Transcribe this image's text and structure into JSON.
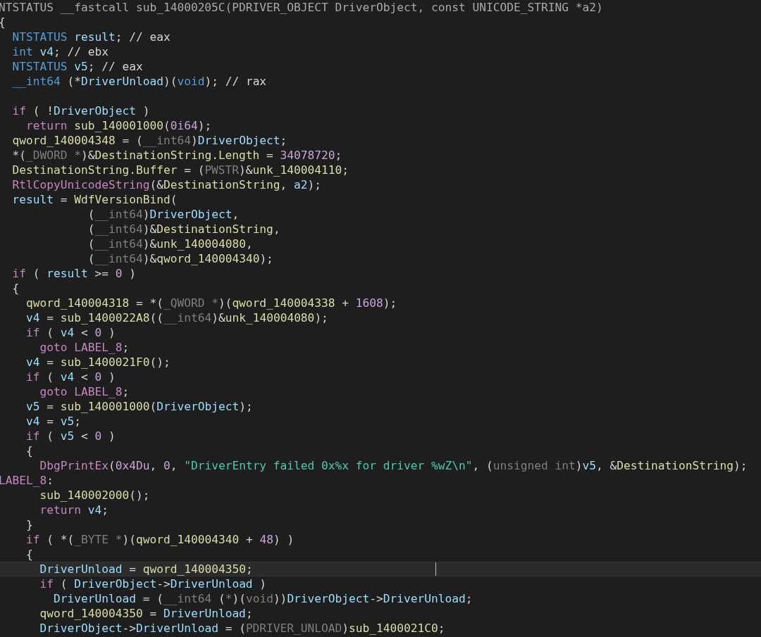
{
  "code_lines": [
    {
      "highlighted": false,
      "tokens": [
        {
          "kind": "header",
          "text": "NTSTATUS __fastcall sub_14000205C(PDRIVER_OBJECT DriverObject, const UNICODE_STRING *a2)"
        }
      ]
    },
    {
      "highlighted": false,
      "tokens": [
        {
          "kind": "plain",
          "text": "{"
        }
      ]
    },
    {
      "highlighted": false,
      "tokens": [
        {
          "kind": "type",
          "text": "  NTSTATUS "
        },
        {
          "kind": "variable",
          "text": "result"
        },
        {
          "kind": "plain",
          "text": "; // eax"
        }
      ]
    },
    {
      "highlighted": false,
      "tokens": [
        {
          "kind": "type",
          "text": "  int "
        },
        {
          "kind": "variable",
          "text": "v4"
        },
        {
          "kind": "plain",
          "text": "; // ebx"
        }
      ]
    },
    {
      "highlighted": false,
      "tokens": [
        {
          "kind": "type",
          "text": "  NTSTATUS "
        },
        {
          "kind": "variable",
          "text": "v5"
        },
        {
          "kind": "plain",
          "text": "; // eax"
        }
      ]
    },
    {
      "highlighted": false,
      "blank_line_after": true,
      "tokens": [
        {
          "kind": "type",
          "text": "  __int64"
        },
        {
          "kind": "plain",
          "text": " (*"
        },
        {
          "kind": "variable",
          "text": "DriverUnload"
        },
        {
          "kind": "plain",
          "text": ")("
        },
        {
          "kind": "type",
          "text": "void"
        },
        {
          "kind": "plain",
          "text": "); // rax"
        }
      ]
    },
    {
      "highlighted": false,
      "tokens": [
        {
          "kind": "keyword",
          "text": "  if"
        },
        {
          "kind": "plain",
          "text": " ( !"
        },
        {
          "kind": "variable",
          "text": "DriverObject"
        },
        {
          "kind": "plain",
          "text": " )"
        }
      ]
    },
    {
      "highlighted": false,
      "tokens": [
        {
          "kind": "keyword",
          "text": "    return "
        },
        {
          "kind": "global",
          "text": "sub_140001000"
        },
        {
          "kind": "plain",
          "text": "("
        },
        {
          "kind": "number",
          "text": "0i64"
        },
        {
          "kind": "plain",
          "text": ");"
        }
      ]
    },
    {
      "highlighted": false,
      "tokens": [
        {
          "kind": "global",
          "text": "  qword_140004348"
        },
        {
          "kind": "plain",
          "text": " = ("
        },
        {
          "kind": "cast",
          "text": "__int64"
        },
        {
          "kind": "plain",
          "text": ")"
        },
        {
          "kind": "variable",
          "text": "DriverObject"
        },
        {
          "kind": "plain",
          "text": ";"
        }
      ]
    },
    {
      "highlighted": false,
      "tokens": [
        {
          "kind": "plain",
          "text": "  *("
        },
        {
          "kind": "cast",
          "text": "_DWORD *"
        },
        {
          "kind": "plain",
          "text": ")&"
        },
        {
          "kind": "global",
          "text": "DestinationString.Length"
        },
        {
          "kind": "plain",
          "text": " = "
        },
        {
          "kind": "number",
          "text": "34078720"
        },
        {
          "kind": "plain",
          "text": ";"
        }
      ]
    },
    {
      "highlighted": false,
      "tokens": [
        {
          "kind": "global",
          "text": "  DestinationString.Buffer"
        },
        {
          "kind": "plain",
          "text": " = ("
        },
        {
          "kind": "cast",
          "text": "PWSTR"
        },
        {
          "kind": "plain",
          "text": ")&"
        },
        {
          "kind": "global",
          "text": "unk_140004110"
        },
        {
          "kind": "plain",
          "text": ";"
        }
      ]
    },
    {
      "highlighted": false,
      "tokens": [
        {
          "kind": "import",
          "text": "  RtlCopyUnicodeString"
        },
        {
          "kind": "plain",
          "text": "(&"
        },
        {
          "kind": "global",
          "text": "DestinationString"
        },
        {
          "kind": "plain",
          "text": ", "
        },
        {
          "kind": "variable",
          "text": "a2"
        },
        {
          "kind": "plain",
          "text": ");"
        }
      ]
    },
    {
      "highlighted": false,
      "tokens": [
        {
          "kind": "variable",
          "text": "  result"
        },
        {
          "kind": "plain",
          "text": " = "
        },
        {
          "kind": "global",
          "text": "WdfVersionBind"
        },
        {
          "kind": "plain",
          "text": "("
        }
      ]
    },
    {
      "highlighted": false,
      "tokens": [
        {
          "kind": "plain",
          "text": "             ("
        },
        {
          "kind": "cast",
          "text": "__int64"
        },
        {
          "kind": "plain",
          "text": ")"
        },
        {
          "kind": "variable",
          "text": "DriverObject"
        },
        {
          "kind": "plain",
          "text": ","
        }
      ]
    },
    {
      "highlighted": false,
      "tokens": [
        {
          "kind": "plain",
          "text": "             ("
        },
        {
          "kind": "cast",
          "text": "__int64"
        },
        {
          "kind": "plain",
          "text": ")&"
        },
        {
          "kind": "global",
          "text": "DestinationString"
        },
        {
          "kind": "plain",
          "text": ","
        }
      ]
    },
    {
      "highlighted": false,
      "tokens": [
        {
          "kind": "plain",
          "text": "             ("
        },
        {
          "kind": "cast",
          "text": "__int64"
        },
        {
          "kind": "plain",
          "text": ")&"
        },
        {
          "kind": "global",
          "text": "unk_140004080"
        },
        {
          "kind": "plain",
          "text": ","
        }
      ]
    },
    {
      "highlighted": false,
      "tokens": [
        {
          "kind": "plain",
          "text": "             ("
        },
        {
          "kind": "cast",
          "text": "__int64"
        },
        {
          "kind": "plain",
          "text": ")&"
        },
        {
          "kind": "global",
          "text": "qword_140004340"
        },
        {
          "kind": "plain",
          "text": ");"
        }
      ]
    },
    {
      "highlighted": false,
      "tokens": [
        {
          "kind": "keyword",
          "text": "  if"
        },
        {
          "kind": "plain",
          "text": " ( "
        },
        {
          "kind": "variable",
          "text": "result"
        },
        {
          "kind": "plain",
          "text": " >= "
        },
        {
          "kind": "number",
          "text": "0"
        },
        {
          "kind": "plain",
          "text": " )"
        }
      ]
    },
    {
      "highlighted": false,
      "tokens": [
        {
          "kind": "plain",
          "text": "  {"
        }
      ]
    },
    {
      "highlighted": false,
      "tokens": [
        {
          "kind": "global",
          "text": "    qword_140004318"
        },
        {
          "kind": "plain",
          "text": " = *("
        },
        {
          "kind": "cast",
          "text": "_QWORD *"
        },
        {
          "kind": "plain",
          "text": ")("
        },
        {
          "kind": "global",
          "text": "qword_140004338"
        },
        {
          "kind": "plain",
          "text": " + "
        },
        {
          "kind": "number",
          "text": "1608"
        },
        {
          "kind": "plain",
          "text": ");"
        }
      ]
    },
    {
      "highlighted": false,
      "tokens": [
        {
          "kind": "variable",
          "text": "    v4"
        },
        {
          "kind": "plain",
          "text": " = "
        },
        {
          "kind": "global",
          "text": "sub_1400022A8"
        },
        {
          "kind": "plain",
          "text": "(("
        },
        {
          "kind": "cast",
          "text": "__int64"
        },
        {
          "kind": "plain",
          "text": ")&"
        },
        {
          "kind": "global",
          "text": "unk_140004080"
        },
        {
          "kind": "plain",
          "text": ");"
        }
      ]
    },
    {
      "highlighted": false,
      "tokens": [
        {
          "kind": "keyword",
          "text": "    if"
        },
        {
          "kind": "plain",
          "text": " ( "
        },
        {
          "kind": "variable",
          "text": "v4"
        },
        {
          "kind": "plain",
          "text": " < "
        },
        {
          "kind": "number",
          "text": "0"
        },
        {
          "kind": "plain",
          "text": " )"
        }
      ]
    },
    {
      "highlighted": false,
      "tokens": [
        {
          "kind": "keyword",
          "text": "      goto "
        },
        {
          "kind": "label",
          "text": "LABEL_8"
        },
        {
          "kind": "plain",
          "text": ";"
        }
      ]
    },
    {
      "highlighted": false,
      "tokens": [
        {
          "kind": "variable",
          "text": "    v4"
        },
        {
          "kind": "plain",
          "text": " = "
        },
        {
          "kind": "global",
          "text": "sub_1400021F0"
        },
        {
          "kind": "plain",
          "text": "();"
        }
      ]
    },
    {
      "highlighted": false,
      "tokens": [
        {
          "kind": "keyword",
          "text": "    if"
        },
        {
          "kind": "plain",
          "text": " ( "
        },
        {
          "kind": "variable",
          "text": "v4"
        },
        {
          "kind": "plain",
          "text": " < "
        },
        {
          "kind": "number",
          "text": "0"
        },
        {
          "kind": "plain",
          "text": " )"
        }
      ]
    },
    {
      "highlighted": false,
      "tokens": [
        {
          "kind": "keyword",
          "text": "      goto "
        },
        {
          "kind": "label",
          "text": "LABEL_8"
        },
        {
          "kind": "plain",
          "text": ";"
        }
      ]
    },
    {
      "highlighted": false,
      "tokens": [
        {
          "kind": "variable",
          "text": "    v5"
        },
        {
          "kind": "plain",
          "text": " = "
        },
        {
          "kind": "global",
          "text": "sub_140001000"
        },
        {
          "kind": "plain",
          "text": "("
        },
        {
          "kind": "variable",
          "text": "DriverObject"
        },
        {
          "kind": "plain",
          "text": ");"
        }
      ]
    },
    {
      "highlighted": false,
      "tokens": [
        {
          "kind": "variable",
          "text": "    v4"
        },
        {
          "kind": "plain",
          "text": " = "
        },
        {
          "kind": "variable",
          "text": "v5"
        },
        {
          "kind": "plain",
          "text": ";"
        }
      ]
    },
    {
      "highlighted": false,
      "tokens": [
        {
          "kind": "keyword",
          "text": "    if"
        },
        {
          "kind": "plain",
          "text": " ( "
        },
        {
          "kind": "variable",
          "text": "v5"
        },
        {
          "kind": "plain",
          "text": " < "
        },
        {
          "kind": "number",
          "text": "0"
        },
        {
          "kind": "plain",
          "text": " )"
        }
      ]
    },
    {
      "highlighted": false,
      "tokens": [
        {
          "kind": "plain",
          "text": "    {"
        }
      ]
    },
    {
      "highlighted": false,
      "tokens": [
        {
          "kind": "import",
          "text": "      DbgPrintEx"
        },
        {
          "kind": "plain",
          "text": "("
        },
        {
          "kind": "number",
          "text": "0x4Du"
        },
        {
          "kind": "plain",
          "text": ", "
        },
        {
          "kind": "number",
          "text": "0"
        },
        {
          "kind": "plain",
          "text": ", "
        },
        {
          "kind": "string",
          "text": "\"DriverEntry failed 0x%x for driver %wZ\\n\""
        },
        {
          "kind": "plain",
          "text": ", ("
        },
        {
          "kind": "cast",
          "text": "unsigned int"
        },
        {
          "kind": "plain",
          "text": ")"
        },
        {
          "kind": "variable",
          "text": "v5"
        },
        {
          "kind": "plain",
          "text": ", &"
        },
        {
          "kind": "global",
          "text": "DestinationString"
        },
        {
          "kind": "plain",
          "text": ");"
        }
      ]
    },
    {
      "highlighted": false,
      "tokens": [
        {
          "kind": "label",
          "text": "LABEL_8"
        },
        {
          "kind": "plain",
          "text": ":"
        }
      ]
    },
    {
      "highlighted": false,
      "tokens": [
        {
          "kind": "global",
          "text": "      sub_140002000"
        },
        {
          "kind": "plain",
          "text": "();"
        }
      ]
    },
    {
      "highlighted": false,
      "tokens": [
        {
          "kind": "keyword",
          "text": "      return "
        },
        {
          "kind": "variable",
          "text": "v4"
        },
        {
          "kind": "plain",
          "text": ";"
        }
      ]
    },
    {
      "highlighted": false,
      "tokens": [
        {
          "kind": "plain",
          "text": "    }"
        }
      ]
    },
    {
      "highlighted": false,
      "tokens": [
        {
          "kind": "keyword",
          "text": "    if"
        },
        {
          "kind": "plain",
          "text": " ( *("
        },
        {
          "kind": "cast",
          "text": "_BYTE *"
        },
        {
          "kind": "plain",
          "text": ")("
        },
        {
          "kind": "global",
          "text": "qword_140004340"
        },
        {
          "kind": "plain",
          "text": " + "
        },
        {
          "kind": "number",
          "text": "48"
        },
        {
          "kind": "plain",
          "text": ") )"
        }
      ]
    },
    {
      "highlighted": false,
      "tokens": [
        {
          "kind": "plain",
          "text": "    {"
        }
      ]
    },
    {
      "highlighted": true,
      "tokens": [
        {
          "kind": "variable",
          "text": "      DriverUnload"
        },
        {
          "kind": "plain",
          "text": " = "
        },
        {
          "kind": "global",
          "text": "qword_140004350"
        },
        {
          "kind": "plain",
          "text": ";"
        }
      ]
    },
    {
      "highlighted": false,
      "tokens": [
        {
          "kind": "keyword",
          "text": "      if"
        },
        {
          "kind": "plain",
          "text": " ( "
        },
        {
          "kind": "variable",
          "text": "DriverObject"
        },
        {
          "kind": "plain",
          "text": "->"
        },
        {
          "kind": "variable",
          "text": "DriverUnload"
        },
        {
          "kind": "plain",
          "text": " )"
        }
      ]
    },
    {
      "highlighted": false,
      "tokens": [
        {
          "kind": "variable",
          "text": "        DriverUnload"
        },
        {
          "kind": "plain",
          "text": " = ("
        },
        {
          "kind": "cast",
          "text": "__int64"
        },
        {
          "kind": "plain",
          "text": " ("
        },
        {
          "kind": "cast",
          "text": "*"
        },
        {
          "kind": "plain",
          "text": ")("
        },
        {
          "kind": "cast",
          "text": "void"
        },
        {
          "kind": "plain",
          "text": "))"
        },
        {
          "kind": "variable",
          "text": "DriverObject"
        },
        {
          "kind": "plain",
          "text": "->"
        },
        {
          "kind": "variable",
          "text": "DriverUnload"
        },
        {
          "kind": "plain",
          "text": ";"
        }
      ]
    },
    {
      "highlighted": false,
      "tokens": [
        {
          "kind": "global",
          "text": "      qword_140004350"
        },
        {
          "kind": "plain",
          "text": " = "
        },
        {
          "kind": "variable",
          "text": "DriverUnload"
        },
        {
          "kind": "plain",
          "text": ";"
        }
      ]
    },
    {
      "highlighted": false,
      "tokens": [
        {
          "kind": "variable",
          "text": "      DriverObject"
        },
        {
          "kind": "plain",
          "text": "->"
        },
        {
          "kind": "variable",
          "text": "DriverUnload"
        },
        {
          "kind": "plain",
          "text": " = ("
        },
        {
          "kind": "cast",
          "text": "PDRIVER_UNLOAD"
        },
        {
          "kind": "plain",
          "text": ")"
        },
        {
          "kind": "global",
          "text": "sub_1400021C0"
        },
        {
          "kind": "plain",
          "text": ";"
        }
      ]
    }
  ]
}
